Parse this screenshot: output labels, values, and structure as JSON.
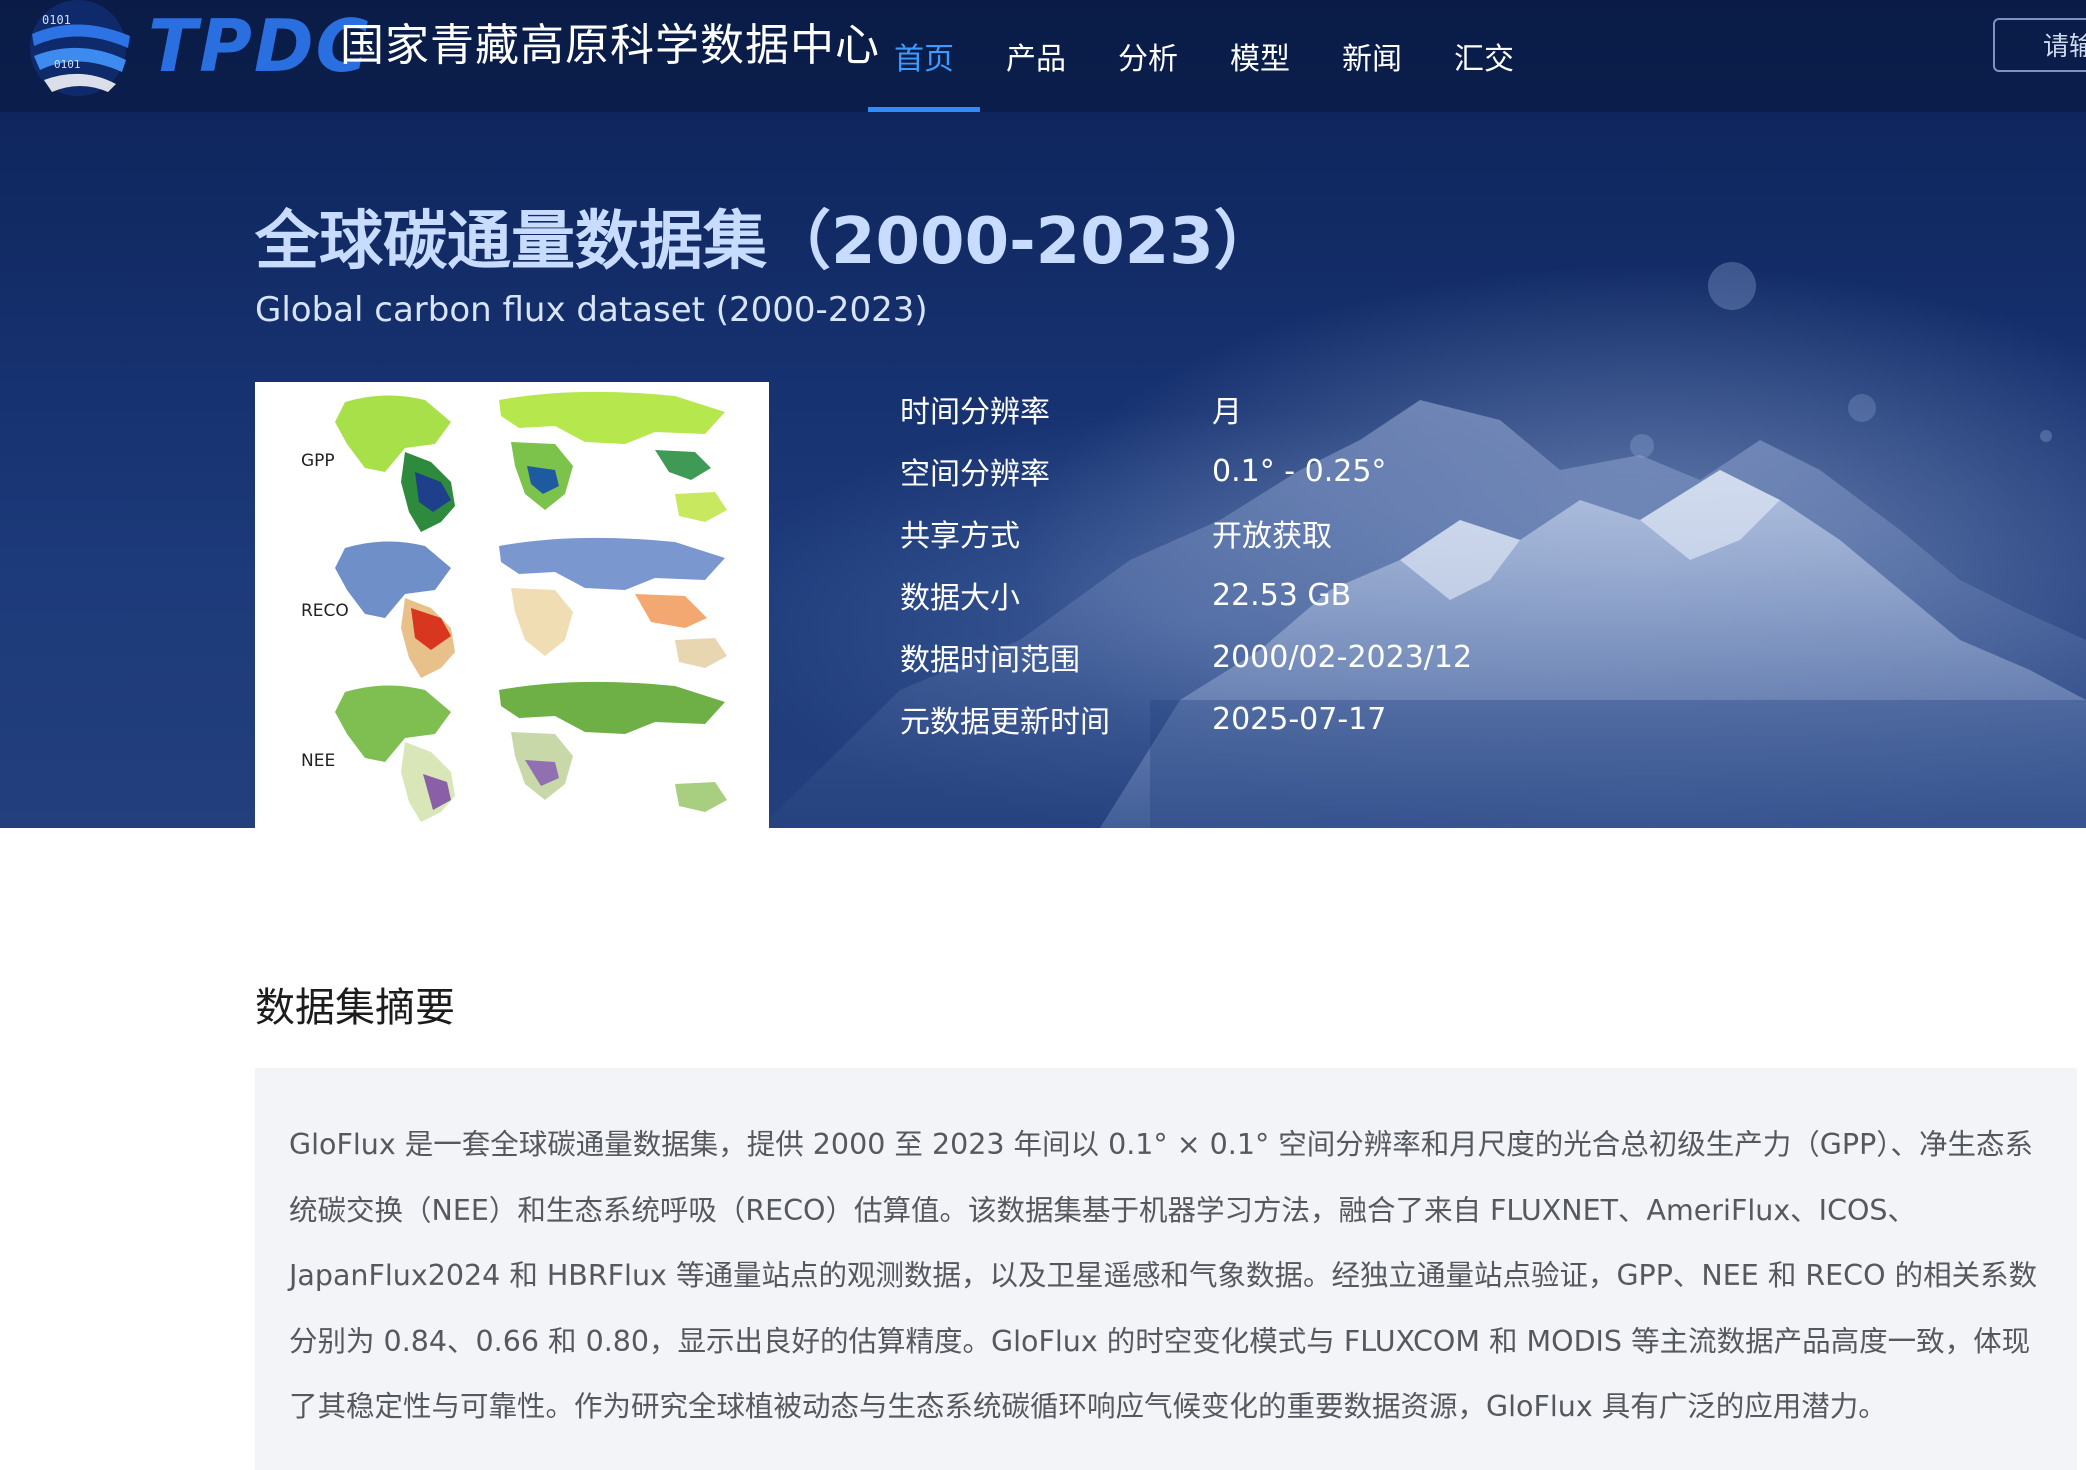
{
  "header": {
    "logo_letters": "TPDC",
    "logo_cn": "国家青藏高原科学数据中心",
    "nav": [
      "首页",
      "产品",
      "分析",
      "模型",
      "新闻",
      "汇交"
    ],
    "active_nav": "首页",
    "search_placeholder": "请输"
  },
  "dataset": {
    "title_cn": "全球碳通量数据集（2000-2023）",
    "title_en": "Global carbon flux dataset (2000-2023)",
    "thumbnail_labels": [
      "GPP",
      "RECO",
      "NEE"
    ],
    "meta": [
      {
        "label": "时间分辨率",
        "value": "月"
      },
      {
        "label": "空间分辨率",
        "value": "0.1° - 0.25°"
      },
      {
        "label": "共享方式",
        "value": "开放获取"
      },
      {
        "label": "数据大小",
        "value": "22.53 GB"
      },
      {
        "label": "数据时间范围",
        "value": "2000/02-2023/12"
      },
      {
        "label": "元数据更新时间",
        "value": "2025-07-17"
      }
    ]
  },
  "abstract": {
    "heading": "数据集摘要",
    "text": "GloFlux 是一套全球碳通量数据集，提供 2000 至 2023 年间以 0.1° × 0.1° 空间分辨率和月尺度的光合总初级生产力（GPP）、净生态系统碳交换（NEE）和生态系统呼吸（RECO）估算值。该数据集基于机器学习方法，融合了来自 FLUXNET、AmeriFlux、ICOS、JapanFlux2024 和 HBRFlux 等通量站点的观测数据，以及卫星遥感和气象数据。经独立通量站点验证，GPP、NEE 和 RECO 的相关系数分别为 0.84、0.66 和 0.80，显示出良好的估算精度。GloFlux 的时空变化模式与 FLUXCOM 和 MODIS 等主流数据产品高度一致，体现了其稳定性与可靠性。作为研究全球植被动态与生态系统碳循环响应气候变化的重要数据资源，GloFlux 具有广泛的应用潜力。"
  },
  "colors": {
    "hero_dark": "#0c2155",
    "nav_active": "#2f8cff",
    "title_cn": "#c8dcff",
    "abstract_bg": "#f3f4f7"
  }
}
